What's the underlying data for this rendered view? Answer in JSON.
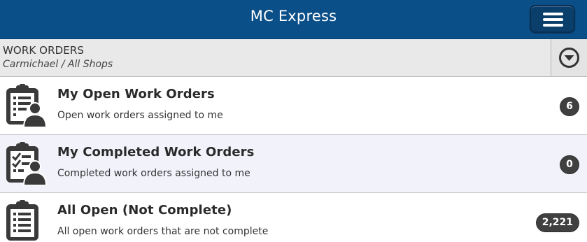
{
  "app": {
    "title": "MC Express"
  },
  "subheader": {
    "title": "WORK ORDERS",
    "breadcrumb": "Carmichael / All Shops"
  },
  "icons": {
    "menu": "hamburger-icon",
    "toggle": "chevron-down-circle-icon",
    "clipboard": "clipboard-icon"
  },
  "colors": {
    "topbar": "#0b4f89",
    "menu_button": "#0a3e6b",
    "subheader": "#e9e9e9",
    "alt_row": "#f2f2fb",
    "badge": "#404040"
  },
  "rows": [
    {
      "title": "My Open Work Orders",
      "description": "Open work orders assigned to me",
      "count": "6"
    },
    {
      "title": "My Completed Work Orders",
      "description": "Completed work orders assigned to me",
      "count": "0"
    },
    {
      "title": "All Open (Not Complete)",
      "description": "All open work orders that are not complete",
      "count": "2,221"
    }
  ]
}
